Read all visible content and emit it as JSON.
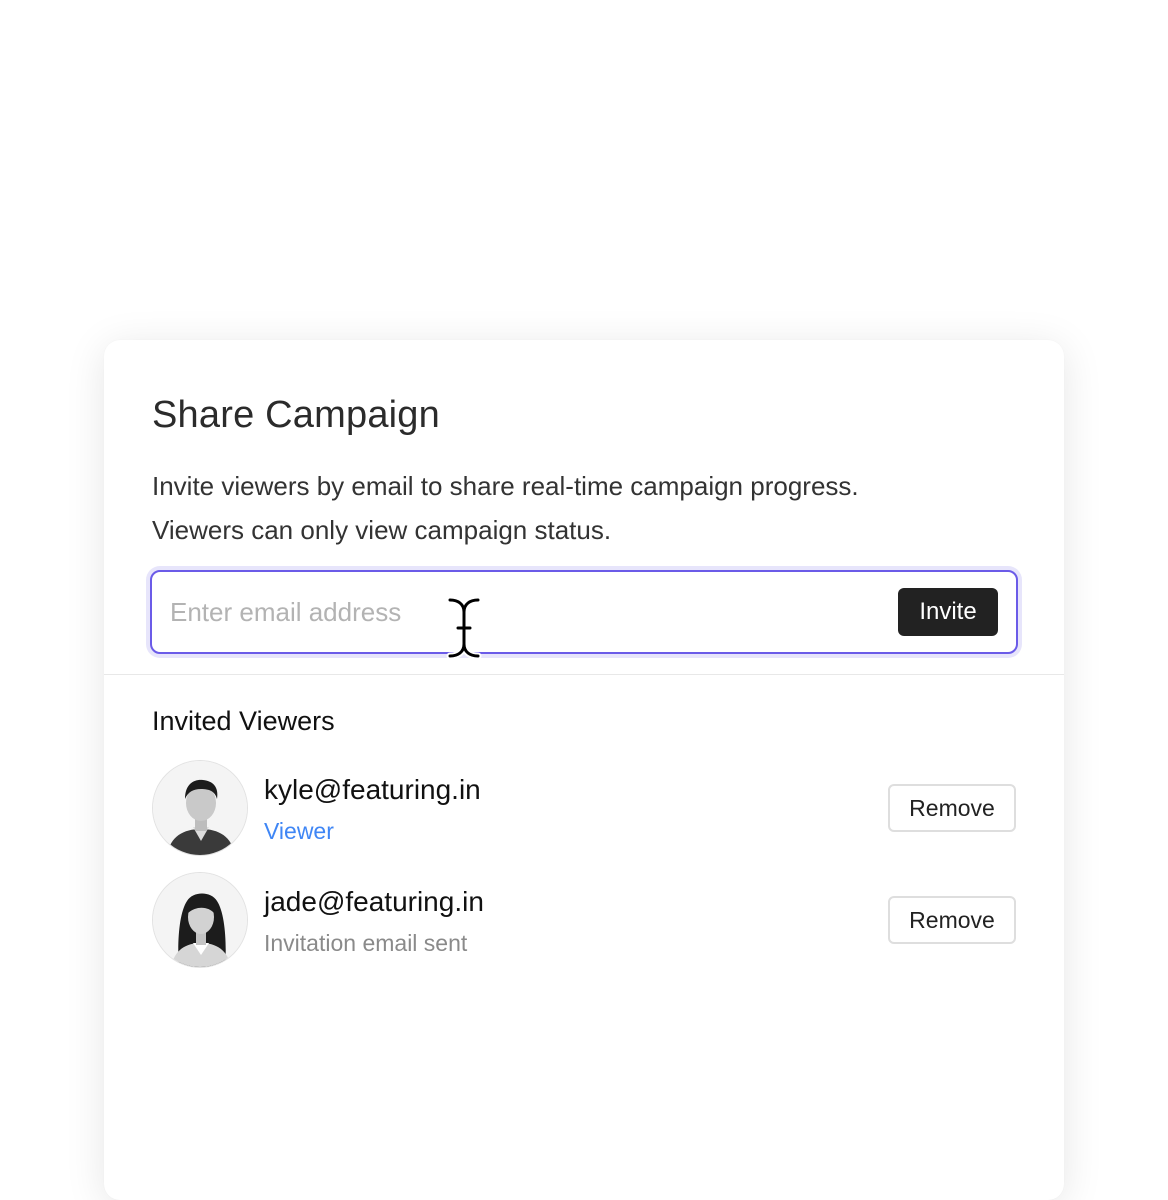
{
  "dialog": {
    "title": "Share Campaign",
    "description_line1": "Invite viewers by email to share real-time campaign progress.",
    "description_line2": "Viewers can only view campaign status."
  },
  "invite": {
    "placeholder": "Enter email address",
    "value": "",
    "button_label": "Invite"
  },
  "invited": {
    "section_title": "Invited Viewers",
    "viewers": [
      {
        "email": "kyle@featuring.in",
        "status": "Viewer",
        "remove_label": "Remove"
      },
      {
        "email": "jade@featuring.in",
        "status": "Invitation email sent",
        "remove_label": "Remove"
      }
    ]
  },
  "colors": {
    "accent": "#6b5be8",
    "role_link": "#3f86f5",
    "primary_button": "#222222"
  },
  "icons": {
    "cursor": "text-cursor-icon"
  }
}
